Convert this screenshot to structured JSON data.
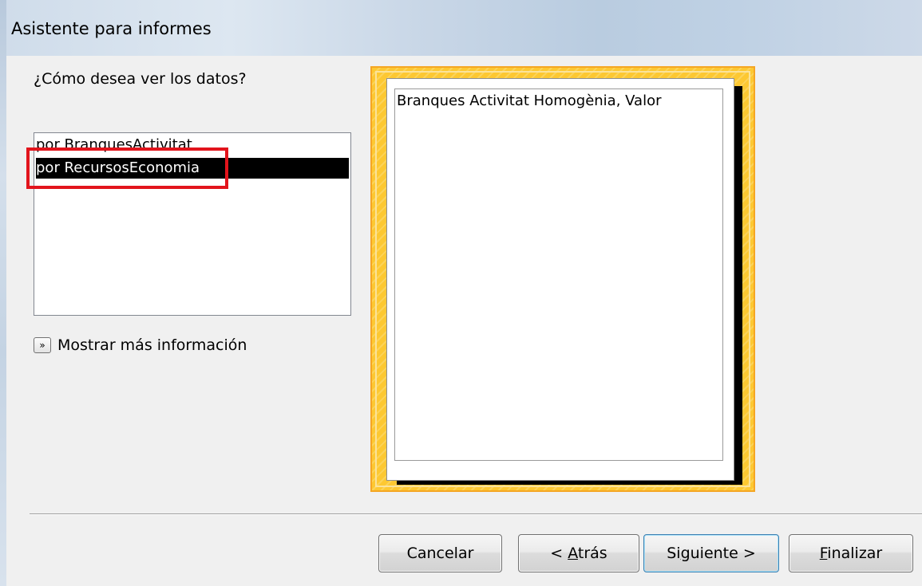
{
  "window": {
    "title": "Asistente para informes"
  },
  "prompt": {
    "question": "¿Cómo desea ver los datos?"
  },
  "view_list": {
    "items": [
      {
        "label": "por BranquesActivitat",
        "selected": false
      },
      {
        "label": "por RecursosEconomia",
        "selected": true
      }
    ]
  },
  "more_info": {
    "label": "Mostrar más información",
    "icon": "double-chevron-icon"
  },
  "preview": {
    "field_text": "Branques Activitat Homogènia, Valor"
  },
  "buttons": {
    "cancel": {
      "label": "Cancelar"
    },
    "back": {
      "prefix": "< ",
      "mnemonic": "A",
      "rest": "trás"
    },
    "next": {
      "prefix": "Si",
      "mnemonic": "g",
      "rest": "uiente >"
    },
    "finish": {
      "prefix": "",
      "mnemonic": "F",
      "rest": "inalizar"
    }
  },
  "colors": {
    "highlight_border": "#e2141c",
    "selection_bg": "#000000",
    "preview_frame": "#fdc832"
  }
}
